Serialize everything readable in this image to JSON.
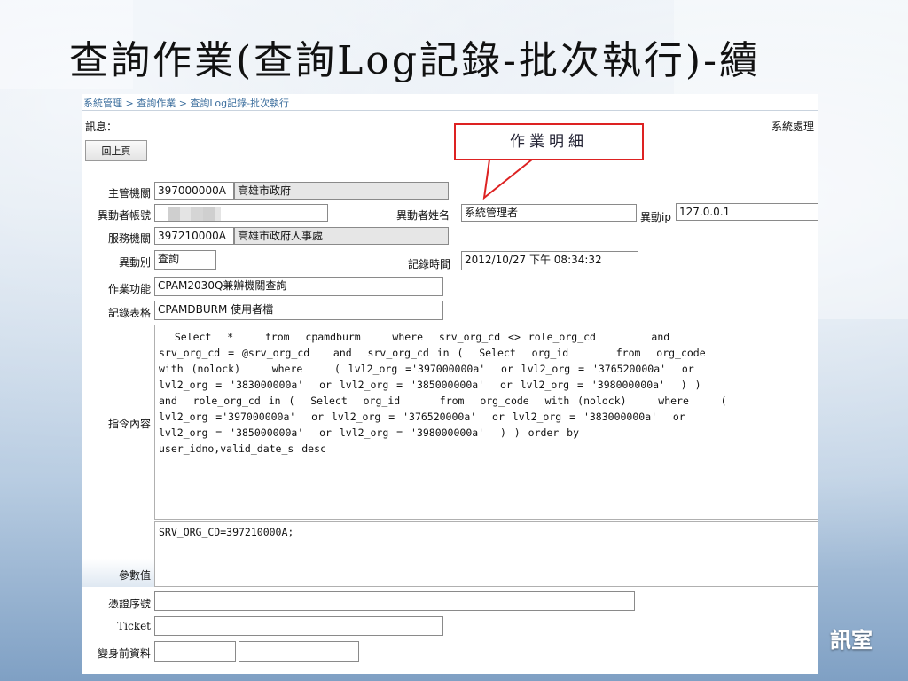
{
  "slide": {
    "title": "查詢作業(查詢Log記錄-批次執行)-續",
    "badge": "訊室"
  },
  "breadcrumb": "系統管理 > 查詢作業 > 查詢Log記錄-批次執行",
  "header": {
    "message_label": "訊息：",
    "system_label": "系統處理",
    "back_button": "回上頁"
  },
  "callout": "作業明細",
  "form": {
    "agency": {
      "label": "主管機關",
      "code": "397000000A",
      "name": "高雄市政府"
    },
    "operator_account": {
      "label": "異動者帳號"
    },
    "operator_name": {
      "label": "異動者姓名",
      "value": "系統管理者"
    },
    "operator_ip": {
      "label": "異動ip",
      "value": "127.0.0.1"
    },
    "service_agency": {
      "label": "服務機關",
      "code": "397210000A",
      "name": "高雄市政府人事處"
    },
    "change_type": {
      "label": "異動別",
      "value": "查詢"
    },
    "record_time": {
      "label": "記錄時間",
      "value": "2012/10/27 下午 08:34:32"
    },
    "function": {
      "label": "作業功能",
      "value": "CPAM2030Q兼辦機關查詢"
    },
    "record_table": {
      "label": "記錄表格",
      "value": "CPAMDBURM 使用者檔"
    },
    "command": {
      "label": "指令內容",
      "value": "  Select  *    from  cpamdburm    where  srv_org_cd <> role_org_cd       and\nsrv_org_cd = @srv_org_cd   and  srv_org_cd in (  Select  org_id      from  org_code\nwith (nolock)    where    ( lvl2_org ='397000000a'  or lvl2_org = '376520000a'  or\nlvl2_org = '383000000a'  or lvl2_org = '385000000a'  or lvl2_org = '398000000a'  ) )\nand  role_org_cd in (  Select  org_id     from  org_code  with (nolock)    where    (\nlvl2_org ='397000000a'  or lvl2_org = '376520000a'  or lvl2_org = '383000000a'  or\nlvl2_org = '385000000a'  or lvl2_org = '398000000a'  ) ) order by\nuser_idno,valid_date_s desc"
    },
    "params": {
      "label": "參數值",
      "value": "SRV_ORG_CD=397210000A;"
    },
    "certificate": {
      "label": "憑證序號",
      "value": ""
    },
    "ticket": {
      "label": "Ticket",
      "value": ""
    },
    "before_data": {
      "label": "變身前資料"
    }
  }
}
